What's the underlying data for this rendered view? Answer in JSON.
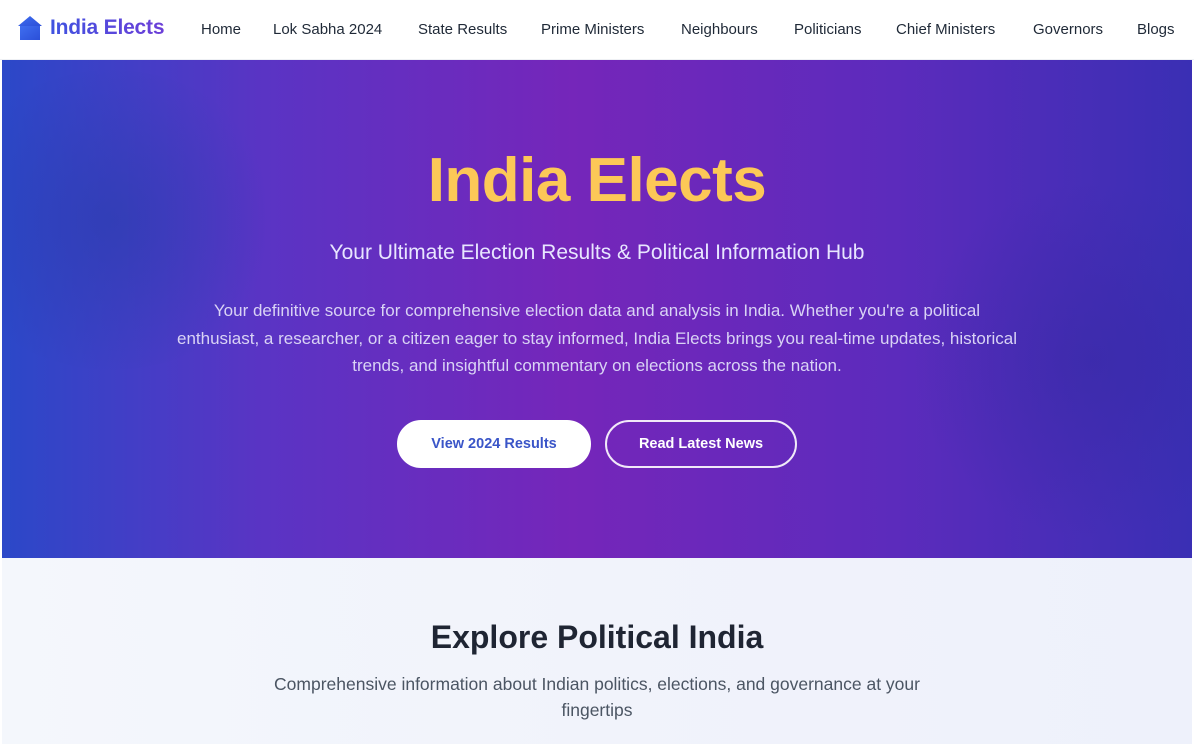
{
  "brand": {
    "name": "India Elects",
    "icon": "parliament-icon",
    "color": "#4f46e5"
  },
  "nav": {
    "links": [
      "Home",
      "Lok Sabha 2024",
      "State Results",
      "Prime Ministers",
      "Neighbours",
      "Politicians",
      "Chief Ministers",
      "Governors",
      "Blogs"
    ]
  },
  "hero": {
    "title": "India Elects",
    "subtitle": "Your Ultimate Election Results & Political Information Hub",
    "description": "Your definitive source for comprehensive election data and analysis in India. Whether you're a political enthusiast, a researcher, or a citizen eager to stay informed, India Elects brings you real-time updates, historical trends, and insightful commentary on elections across the nation.",
    "primary_button": "View 2024 Results",
    "secondary_button": "Read Latest News",
    "title_color": "#fcc857"
  },
  "explore": {
    "title": "Explore Political India",
    "subtitle": "Comprehensive information about Indian politics, elections, and governance at your fingertips"
  }
}
